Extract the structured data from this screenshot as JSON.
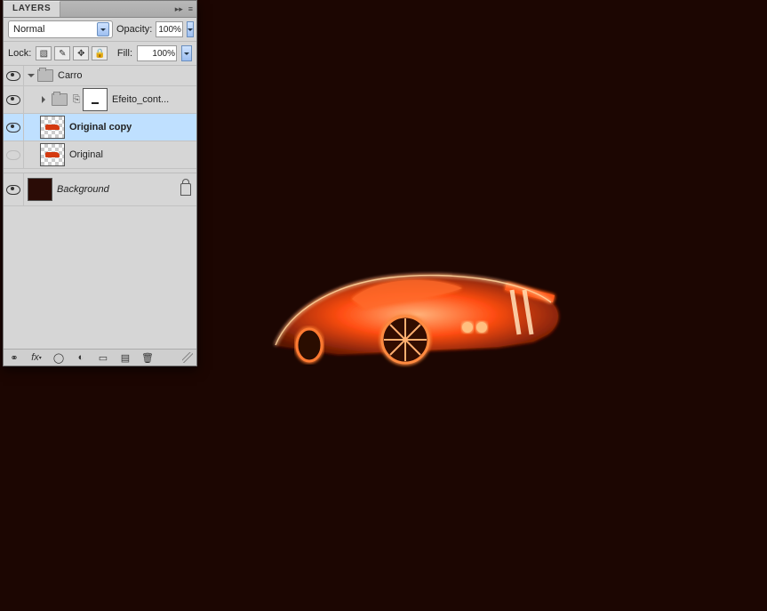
{
  "panel": {
    "tab_title": "LAYERS",
    "blend_mode": "Normal",
    "opacity_label": "Opacity:",
    "opacity_value": "100%",
    "lock_label": "Lock:",
    "fill_label": "Fill:",
    "fill_value": "100%"
  },
  "layers": {
    "group_name": "Carro",
    "child1_name": "Efeito_cont...",
    "child2_name": "Original copy",
    "child3_name": "Original",
    "background_name": "Background"
  },
  "footer_icons": {
    "link": "link-icon",
    "fx": "fx-icon",
    "mask": "mask-icon",
    "adjust": "adjustment-icon",
    "group": "group-icon",
    "new": "new-layer-icon",
    "trash": "trash-icon"
  }
}
